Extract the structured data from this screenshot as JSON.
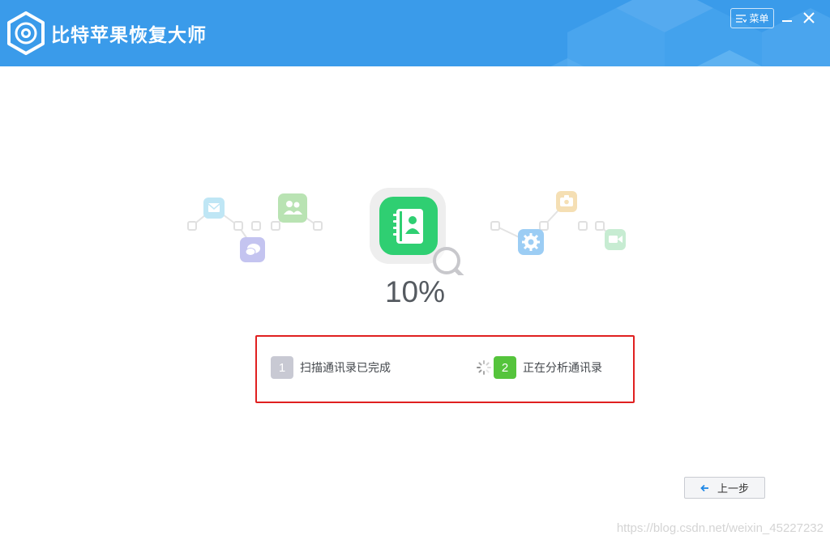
{
  "app": {
    "title": "比特苹果恢复大师"
  },
  "titlebar": {
    "menu_label": "菜单",
    "menu_icon": "menu-list-icon",
    "minimize_icon": "minimize-icon",
    "close_icon": "close-icon"
  },
  "scan": {
    "progress_text": "10%",
    "progress_percent": 10,
    "center_icon": "contacts-book-icon",
    "orbit_icons": [
      "mail-icon",
      "contacts-icon",
      "message-icon",
      "settings-icon",
      "camera-icon",
      "video-icon"
    ]
  },
  "steps": [
    {
      "number": "1",
      "label": "扫描通讯录已完成",
      "state": "done"
    },
    {
      "number": "2",
      "label": "正在分析通讯录",
      "state": "active"
    }
  ],
  "footer": {
    "back_label": "上一步",
    "watermark": "https://blog.csdn.net/weixin_45227232"
  },
  "colors": {
    "header_bg": "#3a9bea",
    "step_done": "#c8c9d3",
    "step_active": "#55c43c",
    "highlight_border": "#e02020",
    "contacts_green": "#2fcf72"
  }
}
